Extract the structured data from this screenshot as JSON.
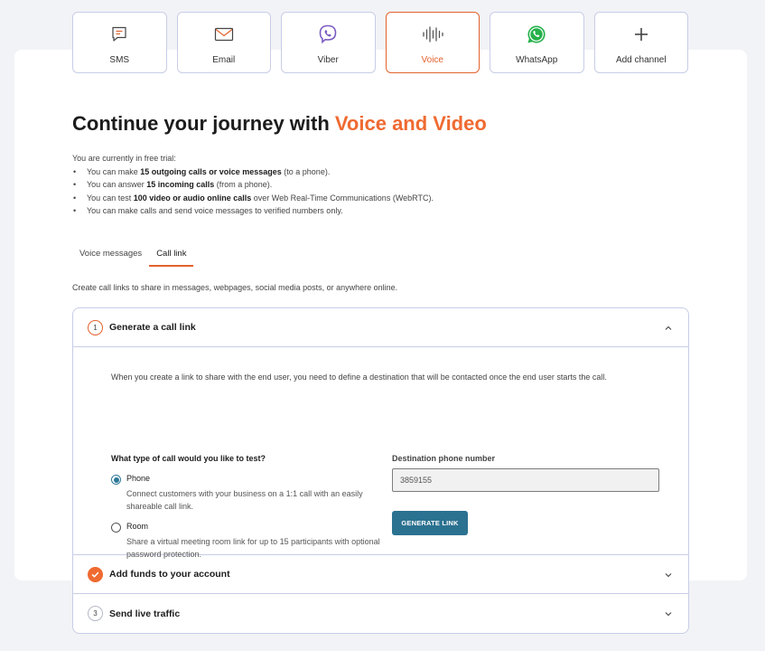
{
  "channels": [
    {
      "label": "SMS",
      "icon": "sms-icon"
    },
    {
      "label": "Email",
      "icon": "email-icon"
    },
    {
      "label": "Viber",
      "icon": "viber-icon"
    },
    {
      "label": "Voice",
      "icon": "voice-icon",
      "active": true
    },
    {
      "label": "WhatsApp",
      "icon": "whatsapp-icon"
    },
    {
      "label": "Add channel",
      "icon": "plus-icon"
    }
  ],
  "title": {
    "prefix": "Continue your journey with ",
    "accent": "Voice and Video"
  },
  "trial": {
    "intro": "You are currently in free trial:",
    "b1": {
      "pre": "You can make ",
      "bold": "15 outgoing calls or voice messages",
      "post": " (to a phone)."
    },
    "b2": {
      "pre": "You can answer ",
      "bold": "15 incoming calls",
      "post": " (from a phone)."
    },
    "b3": {
      "pre": "You can test ",
      "bold": "100 video or audio online calls",
      "post": " over Web Real-Time Communications (WebRTC)."
    },
    "b4": "You can make calls and send voice messages to verified numbers only."
  },
  "tabs": {
    "voice_messages": "Voice messages",
    "call_link": "Call link"
  },
  "description": "Create call links to share in messages, webpages, social media posts, or anywhere online.",
  "steps": {
    "step1": {
      "number": "1",
      "title": "Generate a call link"
    },
    "step2": {
      "title": "Add funds to your account"
    },
    "step3": {
      "number": "3",
      "title": "Send live traffic"
    }
  },
  "generate": {
    "intro": "When you create a link to share with the end user, you need to define a destination that will be contacted once the end user starts the call.",
    "question": "What type of call would you like to test?",
    "phone_label": "Phone",
    "phone_desc": "Connect customers with your business on a 1:1 call with an easily shareable call link.",
    "room_label": "Room",
    "room_desc": "Share a virtual meeting room link for up to 15 participants with optional password protection.",
    "selected": "Phone",
    "dest_label": "Destination phone number",
    "dest_value": "3859155",
    "button": "GENERATE LINK"
  },
  "colors": {
    "accent": "#ef6a31",
    "primary_button": "#2b7190",
    "border": "#c8cde6"
  }
}
